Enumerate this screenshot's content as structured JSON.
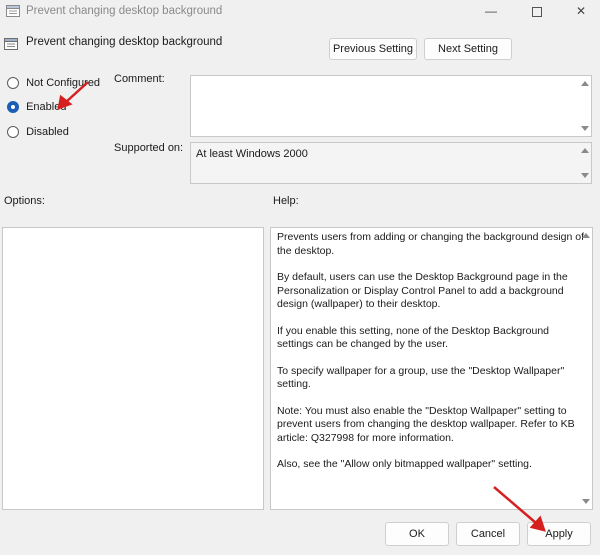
{
  "window": {
    "title": "Prevent changing desktop background",
    "minimize_glyph": "—",
    "close_glyph": "✕"
  },
  "header": {
    "policy_name": "Prevent changing desktop background",
    "previous_setting_label": "Previous Setting",
    "next_setting_label": "Next Setting"
  },
  "state": {
    "options": [
      {
        "label": "Not Configured",
        "checked": false
      },
      {
        "label": "Enabled",
        "checked": true
      },
      {
        "label": "Disabled",
        "checked": false
      }
    ]
  },
  "comment": {
    "label": "Comment:",
    "value": ""
  },
  "supported": {
    "label": "Supported on:",
    "value": "At least Windows 2000"
  },
  "options_section": {
    "label": "Options:"
  },
  "help": {
    "label": "Help:",
    "paragraphs": [
      "Prevents users from adding or changing the background design of the desktop.",
      "By default, users can use the Desktop Background page in the Personalization or Display Control Panel to add a background design (wallpaper) to their desktop.",
      "If you enable this setting, none of the Desktop Background settings can be changed by the user.",
      "To specify wallpaper for a group, use the \"Desktop Wallpaper\" setting.",
      "Note: You must also enable the \"Desktop Wallpaper\" setting to prevent users from changing the desktop wallpaper. Refer to KB article: Q327998 for more information.",
      "Also, see the \"Allow only bitmapped wallpaper\" setting."
    ]
  },
  "footer": {
    "ok_label": "OK",
    "cancel_label": "Cancel",
    "apply_label": "Apply"
  },
  "colors": {
    "annotation_arrow": "#d62020",
    "radio_accent": "#1a5fb4"
  }
}
